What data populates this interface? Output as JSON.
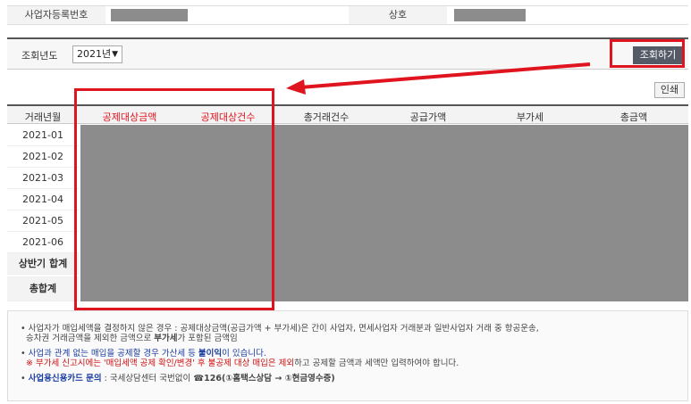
{
  "info": {
    "biz_no_label": "사업자등록번호",
    "name_label": "상호"
  },
  "search": {
    "year_label": "조회년도",
    "year_value": "2021년",
    "query_button": "조회하기"
  },
  "print_button": "인쇄",
  "table": {
    "columns": [
      "거래년월",
      "공제대상금액",
      "공제대상건수",
      "총거래건수",
      "공급가액",
      "부가세",
      "총금액"
    ],
    "rows": [
      "2021-01",
      "2021-02",
      "2021-03",
      "2021-04",
      "2021-05",
      "2021-06",
      "상반기 합계",
      "총합계"
    ]
  },
  "notice": {
    "n1a": "사업자가 매입세액을 결정하지 않은 경우 : 공제대상금액(공급가액 + 부가세)은 간이 사업자, 면세사업자 거래분과 일반사업자 거래 중 항공운송,",
    "n1b": "승차권 거래금액을 제외한 금액으로",
    "n1c": "부가세",
    "n1d": "가 포함된 금액임",
    "n2a": "사업과 관계 없는 매입을 공제할 경우 가산세 등",
    "n2b": "불이익",
    "n2c": "이 있습니다.",
    "n3a": "※ 부가세 신고시에는 '매입세액 공제 확인/변경' 후 불공제 대상 매입은 제외",
    "n3b": "하고 공제할 금액과 세액만 입력하여야 합니다.",
    "n4a": "사업용신용카드 문의",
    "n4b": " : 국세상담센터 국번없이 ",
    "n4c": "☎126(①홈택스상담 → ①현금영수증)"
  },
  "colors": {
    "highlight": "#e0141e",
    "mask": "#8c8c8c",
    "button": "#555b66"
  }
}
